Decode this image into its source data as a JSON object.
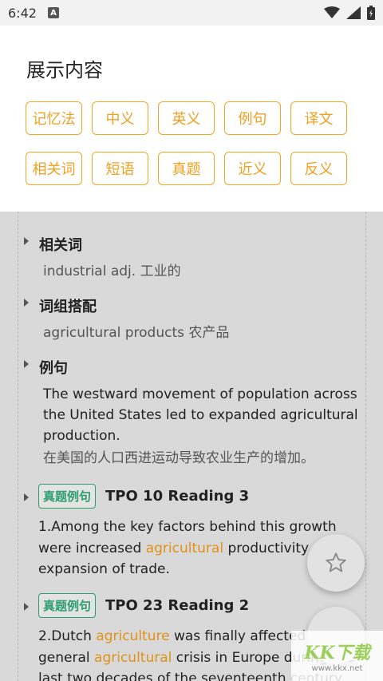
{
  "status": {
    "time": "6:42",
    "notif_letter": "A"
  },
  "sheet": {
    "title": "展示内容",
    "chips": [
      "记忆法",
      "中义",
      "英义",
      "例句",
      "译文",
      "相关词",
      "短语",
      "真题",
      "近义",
      "反义"
    ]
  },
  "content": {
    "cut_line": "...",
    "related": {
      "title": "相关词",
      "body": "industrial adj. 工业的"
    },
    "phrase": {
      "title": "词组搭配",
      "body": "agricultural products 农产品"
    },
    "example": {
      "title": "例句",
      "en": "The westward movement of population across the United States led to expanded agricultural production.",
      "cn": "在美国的人口西进运动导致农业生产的增加。"
    },
    "exam1": {
      "badge": "真题例句",
      "title": "TPO 10 Reading 3",
      "pre": "1.Among the key factors behind this growth were increased ",
      "hl": "agricultural",
      "post": " productivity and an expansion of trade."
    },
    "exam2": {
      "badge": "真题例句",
      "title": "TPO 23 Reading 2",
      "pre": "2.Dutch ",
      "hl1": "agriculture",
      "mid": " was finally affected by the general ",
      "hl2": "agricultural",
      "post": " crisis in Europe during the last two decades of the seventeenth century"
    }
  },
  "watermark": {
    "text": "KK下载",
    "url": "www.kkx.net"
  }
}
